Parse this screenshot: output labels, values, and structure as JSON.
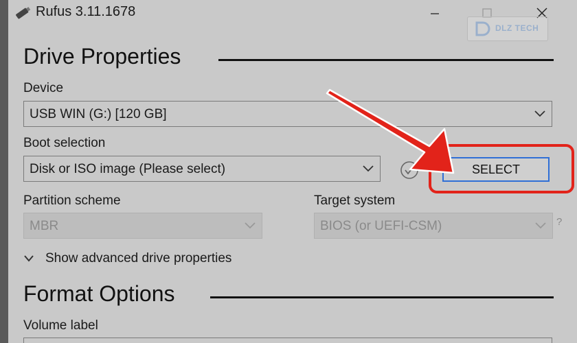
{
  "window": {
    "title": "Rufus 3.11.1678"
  },
  "watermark": {
    "text": "DLZ TECH"
  },
  "drive_properties": {
    "heading": "Drive Properties",
    "device": {
      "label": "Device",
      "value": "USB WIN (G:) [120 GB]"
    },
    "boot_selection": {
      "label": "Boot selection",
      "value": "Disk or ISO image (Please select)",
      "button": "SELECT"
    },
    "partition_scheme": {
      "label": "Partition scheme",
      "value": "MBR"
    },
    "target_system": {
      "label": "Target system",
      "value": "BIOS (or UEFI-CSM)",
      "help": "?"
    },
    "advanced_toggle": "Show advanced drive properties"
  },
  "format_options": {
    "heading": "Format Options",
    "volume_label": {
      "label": "Volume label"
    }
  },
  "colors": {
    "annotation": "#e2231a",
    "focus": "#2f6fd6",
    "window": "#c9c9c9"
  }
}
